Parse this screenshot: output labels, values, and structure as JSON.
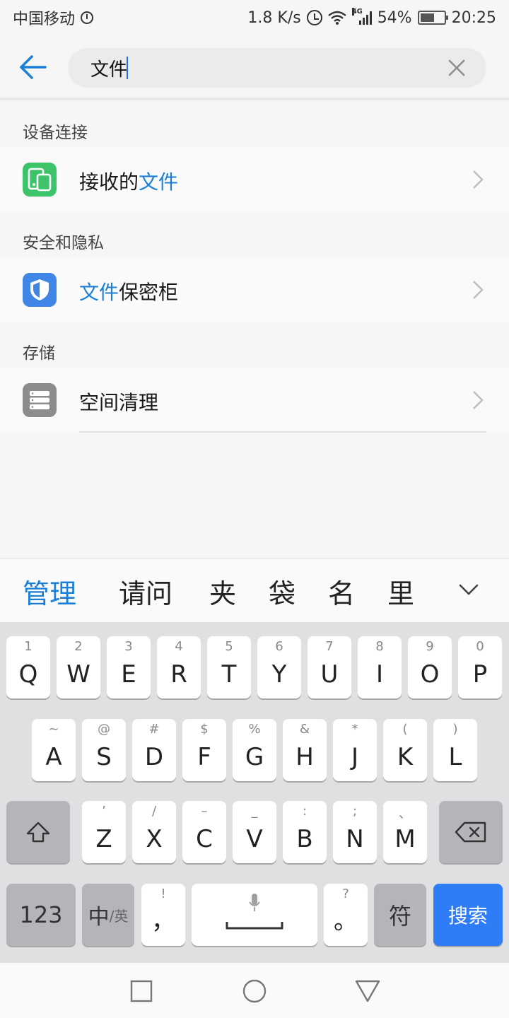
{
  "status": {
    "carrier": "中国移动",
    "speed": "1.8 K/s",
    "network": "4G",
    "battery": "54%",
    "time": "20:25"
  },
  "search": {
    "value": "文件",
    "placeholder": ""
  },
  "sections": [
    {
      "title": "设备连接",
      "item": {
        "prefix": "接收的",
        "highlight": "文件",
        "suffix": ""
      }
    },
    {
      "title": "安全和隐私",
      "item": {
        "prefix": "",
        "highlight": "文件",
        "suffix": "保密柜"
      }
    },
    {
      "title": "存储",
      "item": {
        "prefix": "空间清理",
        "highlight": "",
        "suffix": ""
      }
    }
  ],
  "candidates": [
    "管理",
    "请问",
    "夹",
    "袋",
    "名",
    "里"
  ],
  "keyboard": {
    "row1": [
      {
        "sub": "1",
        "main": "Q"
      },
      {
        "sub": "2",
        "main": "W"
      },
      {
        "sub": "3",
        "main": "E"
      },
      {
        "sub": "4",
        "main": "R"
      },
      {
        "sub": "5",
        "main": "T"
      },
      {
        "sub": "6",
        "main": "Y"
      },
      {
        "sub": "7",
        "main": "U"
      },
      {
        "sub": "8",
        "main": "I"
      },
      {
        "sub": "9",
        "main": "O"
      },
      {
        "sub": "0",
        "main": "P"
      }
    ],
    "row2": [
      {
        "sub": "~",
        "main": "A"
      },
      {
        "sub": "@",
        "main": "S"
      },
      {
        "sub": "#",
        "main": "D"
      },
      {
        "sub": "$",
        "main": "F"
      },
      {
        "sub": "%",
        "main": "G"
      },
      {
        "sub": "&",
        "main": "H"
      },
      {
        "sub": "*",
        "main": "J"
      },
      {
        "sub": "(",
        "main": "K"
      },
      {
        "sub": ")",
        "main": "L"
      }
    ],
    "row3": [
      {
        "sub": "’",
        "main": "Z"
      },
      {
        "sub": "/",
        "main": "X"
      },
      {
        "sub": "–",
        "main": "C"
      },
      {
        "sub": "_",
        "main": "V"
      },
      {
        "sub": ":",
        "main": "B"
      },
      {
        "sub": ";",
        "main": "N"
      },
      {
        "sub": "、",
        "main": "M"
      }
    ],
    "num_label": "123",
    "lang_main": "中",
    "lang_sub": "/英",
    "comma_sub": "!",
    "comma_main": "，",
    "period_sub": "?",
    "period_main": "。",
    "symbol_label": "符",
    "search_label": "搜索"
  },
  "colors": {
    "accent": "#1b7fd6",
    "search_key": "#2e7cf6",
    "icon_green": "#3dc46a",
    "icon_blue": "#3f86e6",
    "icon_gray": "#8c8c8c"
  }
}
